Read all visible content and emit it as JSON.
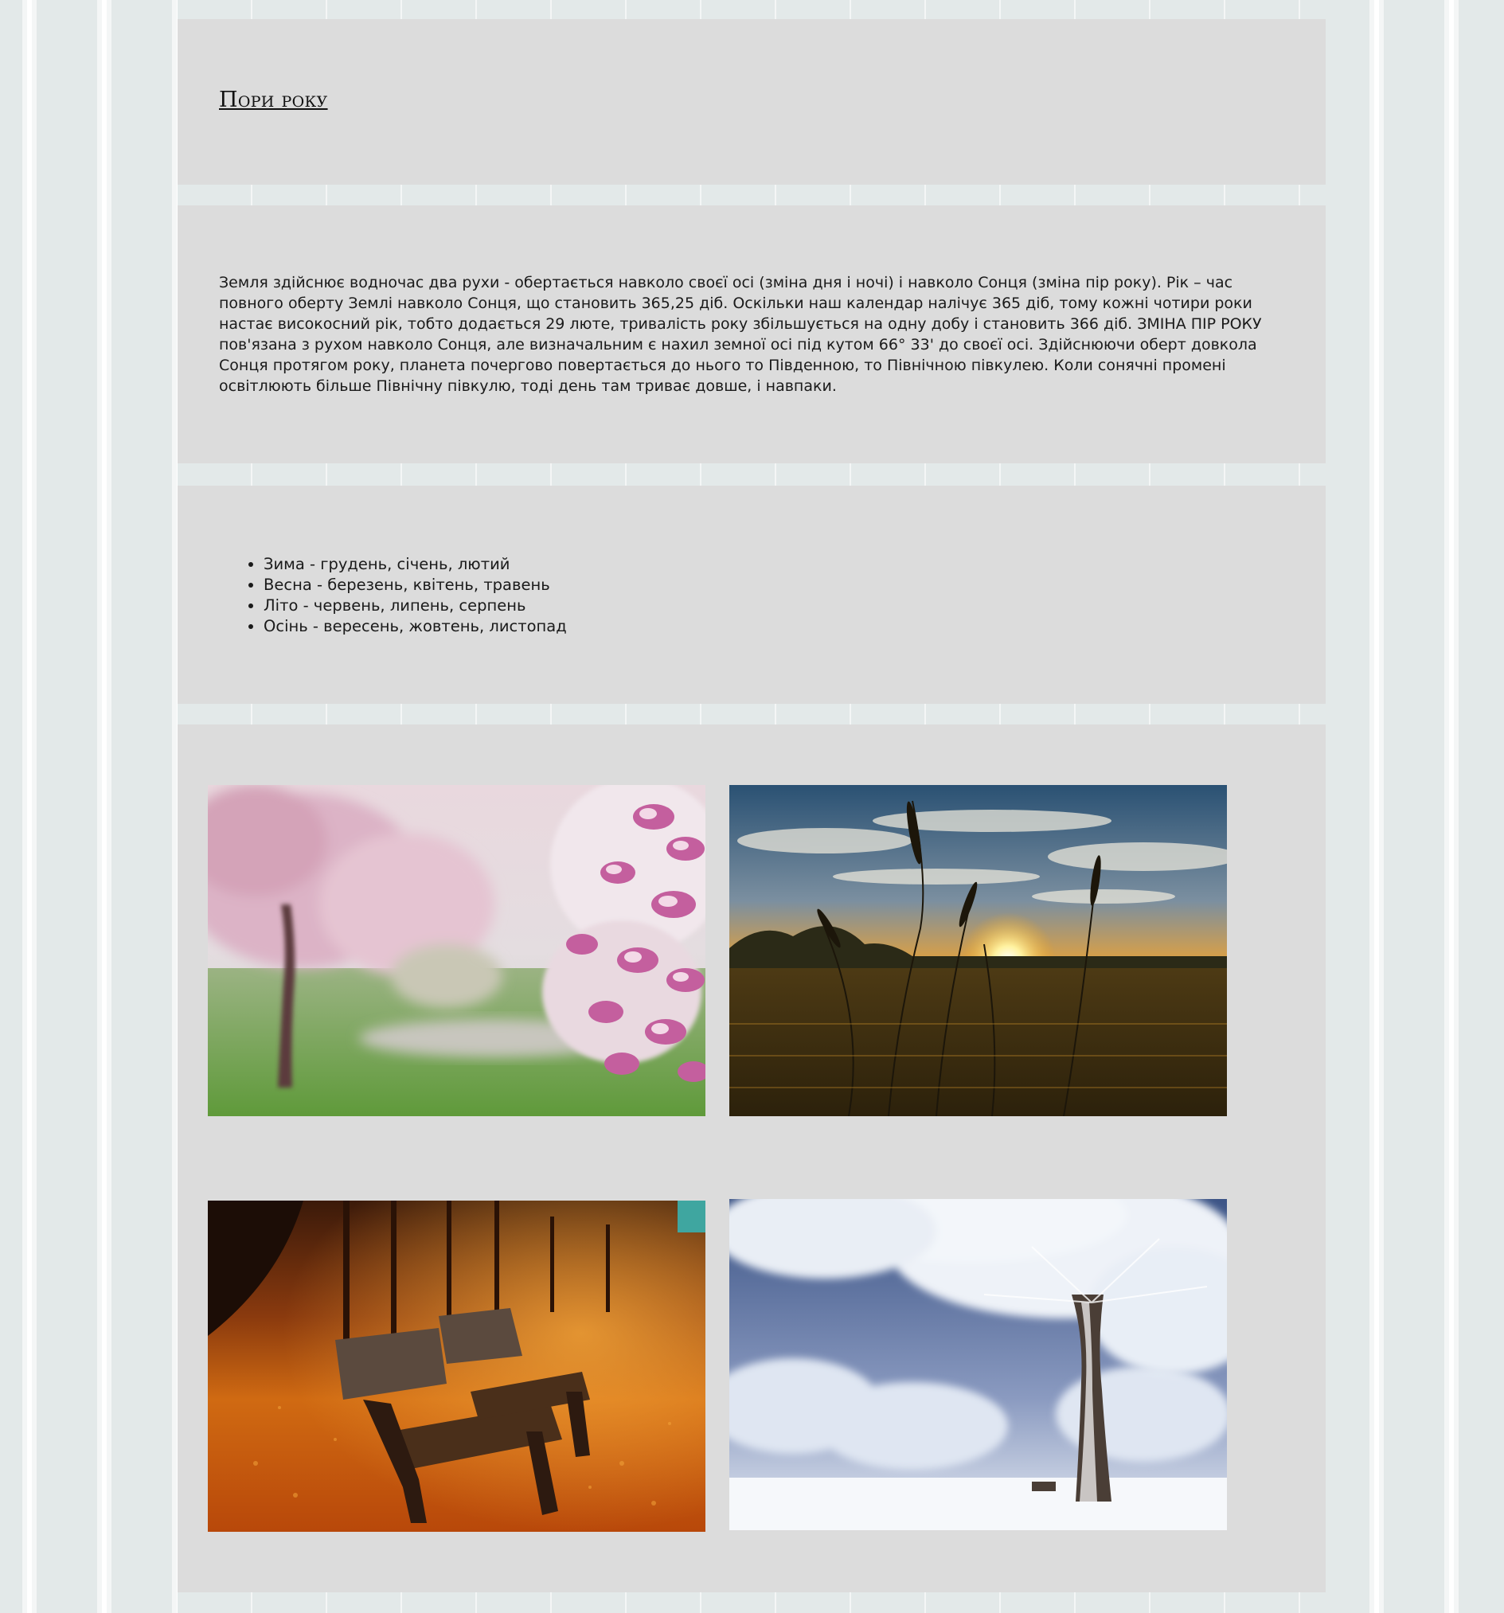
{
  "header": {
    "title": "Пори року"
  },
  "intro": {
    "text": "Земля здійснює водночас два рухи - обертається навколо своєї осі (зміна дня і ночі) і навколо Сонця (зміна пір року). Рік – час повного оберту Землі навколо Сонця, що становить 365,25 діб. Оскільки наш календар налічує 365 діб, тому кожні чотири роки настає високосний рік, тобто додається 29 люте, тривалість року збільшується на одну добу і становить 366 діб. ЗМІНА ПІР РОКУ пов'язана з рухом навколо Сонця, але визначальним є нахил земної осі під кутом 66° 33' до своєї осі. Здійснюючи оберт довкола Сонця протягом року, планета почергово повертається до нього то Південною, то Північною півкулею. Коли сонячні промені освітлюють більше Північну півкулю, тоді день там триває довше, і навпаки."
  },
  "seasons": [
    "Зима - грудень, січень, лютий",
    "Весна - березень, квітень, травень",
    "Літо - червень, липень, серпень",
    "Осінь - вересень, жовтень, листопад"
  ],
  "gallery": {
    "images": [
      {
        "subject": "spring-blossom-photo"
      },
      {
        "subject": "summer-sunset-grass-photo"
      },
      {
        "subject": "autumn-benches-photo"
      },
      {
        "subject": "winter-frosted-tree-photo"
      }
    ]
  },
  "colors": {
    "page_background": "#e3e9e9",
    "stripe_light": "#ffffff",
    "panel_background": "#dcdcdc",
    "text": "#1a1a1a"
  }
}
